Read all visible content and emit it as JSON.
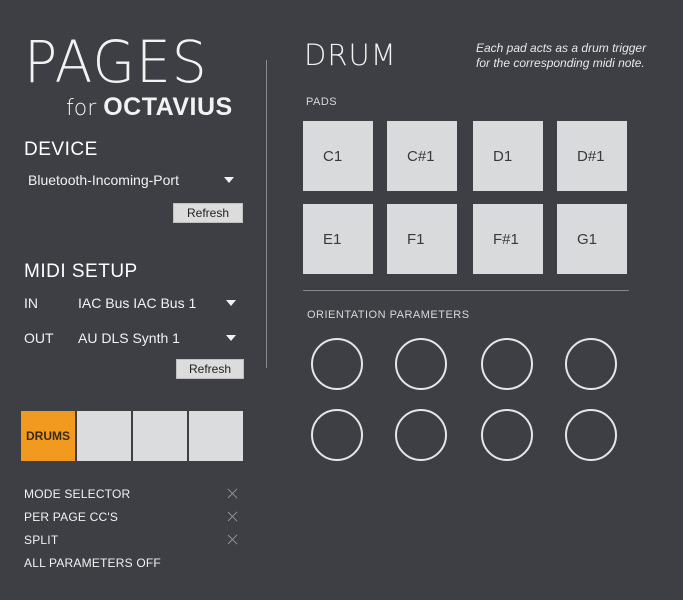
{
  "brand": {
    "title": "PAGES",
    "sub_for": "for",
    "sub_name": "OCTAVIUS"
  },
  "device": {
    "heading": "DEVICE",
    "selected": "Bluetooth-Incoming-Port",
    "refresh_label": "Refresh"
  },
  "midi_setup": {
    "heading": "MIDI SETUP",
    "in_label": "IN",
    "in_selected": "IAC Bus IAC Bus 1",
    "out_label": "OUT",
    "out_selected": "AU DLS Synth 1",
    "refresh_label": "Refresh"
  },
  "mode_tabs": [
    {
      "label": "DRUMS",
      "active": true
    },
    {
      "label": "",
      "active": false
    },
    {
      "label": "",
      "active": false
    },
    {
      "label": "",
      "active": false
    }
  ],
  "options": [
    {
      "label": "MODE SELECTOR",
      "has_close": true
    },
    {
      "label": "PER PAGE CC'S",
      "has_close": true
    },
    {
      "label": "SPLIT",
      "has_close": true
    },
    {
      "label": "ALL PARAMETERS OFF",
      "has_close": false
    }
  ],
  "drum": {
    "title": "DRUM",
    "description": "Each pad acts as a drum trigger for the corresponding midi note.",
    "pads_label": "PADS",
    "pads": [
      "C1",
      "C#1",
      "D1",
      "D#1",
      "E1",
      "F1",
      "F#1",
      "G1"
    ],
    "orientation_label": "ORIENTATION PARAMETERS",
    "knob_count": 8
  },
  "colors": {
    "background": "#3d3f44",
    "accent": "#f29a1f",
    "pad": "#d8dadc"
  },
  "icons": {
    "dropdown": "chevron-down-icon",
    "close": "close-icon"
  }
}
